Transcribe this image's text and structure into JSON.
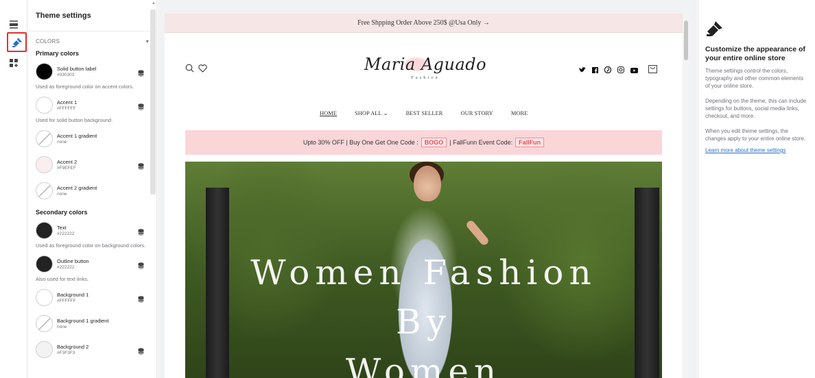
{
  "settings_panel": {
    "title": "Theme settings",
    "section": "COLORS",
    "primary_title": "Primary colors",
    "secondary_title": "Secondary colors",
    "primary": [
      {
        "name": "Solid button label",
        "value": "#030303",
        "color": "#030303",
        "help": "Used as foreground color on accent colors.",
        "db": true
      },
      {
        "name": "Accent 1",
        "value": "#FFFFFF",
        "color": "#FFFFFF",
        "help": "Used for solid button background.",
        "db": true
      },
      {
        "name": "Accent 1 gradient",
        "value": "none",
        "color": "none",
        "help": "",
        "db": false
      },
      {
        "name": "Accent 2",
        "value": "#F9EFEF",
        "color": "#F9EFEF",
        "help": "",
        "db": true
      },
      {
        "name": "Accent 2 gradient",
        "value": "none",
        "color": "none",
        "help": "",
        "db": false
      }
    ],
    "secondary": [
      {
        "name": "Text",
        "value": "#222222",
        "color": "#222222",
        "help": "Used as foreground color on background colors.",
        "db": true
      },
      {
        "name": "Outline button",
        "value": "#222222",
        "color": "#222222",
        "help": "Also used for text links.",
        "db": true
      },
      {
        "name": "Background 1",
        "value": "#FFFFFF",
        "color": "#FFFFFF",
        "help": "",
        "db": true
      },
      {
        "name": "Background 1 gradient",
        "value": "none",
        "color": "none",
        "help": "",
        "db": false
      },
      {
        "name": "Background 2",
        "value": "#F3F3F3",
        "color": "#F3F3F3",
        "help": "",
        "db": true
      }
    ]
  },
  "store": {
    "announcement": "Free Shpping Order Above 250$ @Usa Only  →",
    "logo_name": "Maria Aguado",
    "logo_sub": "Fashion",
    "nav": [
      "HOME",
      "SHOP ALL",
      "BEST SELLER",
      "OUR STORY",
      "MORE"
    ],
    "promo_prefix": "Upto 30% OFF | Buy One Get One Code :",
    "promo_code1": "BOGO",
    "promo_middle": "| FallFunn Event Code:",
    "promo_code2": "FallFun",
    "hero_line1": "Women Fashion",
    "hero_line2": "By",
    "hero_line3": "Women"
  },
  "info_panel": {
    "title": "Customize the appearance of your entire online store",
    "p1": "Theme settings control the colors, typography and other common elements of your online store.",
    "p2": "Depending on the theme, this can include settings for buttons, social media links, checkout, and more.",
    "p3": "When you edit theme settings, the changes apply to your entire online store.",
    "link": "Learn more about theme settings"
  },
  "colors": {
    "accent_red": "#e0312f",
    "promo_bg": "#fad6d8",
    "announce_bg": "#f6e6e6",
    "link_blue": "#2c6ecb"
  }
}
